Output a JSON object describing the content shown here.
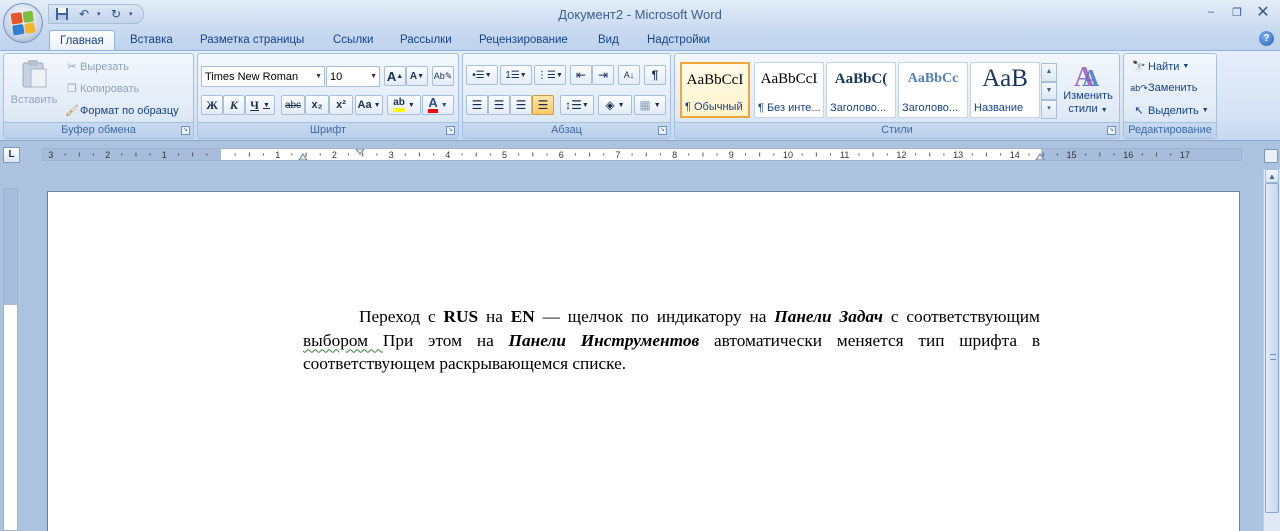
{
  "window": {
    "title": "Документ2 - Microsoft Word",
    "minimize": "–",
    "restore": "❐",
    "close": "✕"
  },
  "tabs": [
    "Главная",
    "Вставка",
    "Разметка страницы",
    "Ссылки",
    "Рассылки",
    "Рецензирование",
    "Вид",
    "Надстройки"
  ],
  "clipboard": {
    "group": "Буфер обмена",
    "paste": "Вставить",
    "cut": "Вырезать",
    "copy": "Копировать",
    "format_painter": "Формат по образцу"
  },
  "font": {
    "group": "Шрифт",
    "family": "Times New Roman",
    "size": "10",
    "bold": "Ж",
    "italic": "К",
    "underline": "Ч",
    "strike": "abc",
    "subscript": "x₂",
    "superscript": "x²",
    "case": "Aa",
    "grow": "A",
    "shrink": "A",
    "highlight": "ab",
    "color": "A"
  },
  "paragraph": {
    "group": "Абзац",
    "pilcrow": "¶"
  },
  "styles": {
    "group": "Стили",
    "items": [
      {
        "sample": "AaBbCcI",
        "name": "¶ Обычный"
      },
      {
        "sample": "AaBbCcI",
        "name": "¶ Без инте..."
      },
      {
        "sample": "AaBbC(",
        "name": "Заголово..."
      },
      {
        "sample": "AaBbCc",
        "name": "Заголово..."
      },
      {
        "sample": "AaB",
        "name": "Название"
      }
    ],
    "change_styles_line1": "Изменить",
    "change_styles_line2": "стили"
  },
  "editing": {
    "group": "Редактирование",
    "find": "Найти",
    "replace": "Заменить",
    "select": "Выделить"
  },
  "ruler": {
    "corner": "L",
    "labels": [
      "3",
      "2",
      "1",
      "1",
      "2",
      "3",
      "4",
      "5",
      "6",
      "7",
      "8",
      "9",
      "10",
      "11",
      "12",
      "13",
      "14",
      "15",
      "16",
      "17"
    ]
  },
  "document": {
    "p1": "Переход с ",
    "b1": "RUS",
    "p2": " на ",
    "b2": "EN",
    "p3": " — щелчок по индикатору на ",
    "bi1": "Панели Задач",
    "p4": " с соответствующим ",
    "sq": "выбором ",
    "p5": "При этом на ",
    "bi2": "Панели Инструментов",
    "p6": " автоматически меняется тип шрифта в соответствующем раскрывающемся списке."
  },
  "colors": {
    "accent": "#15428b",
    "ribbon_bg": "#d6e3f5",
    "highlight_yellow": "#ffff00",
    "font_red": "#ff0000"
  }
}
